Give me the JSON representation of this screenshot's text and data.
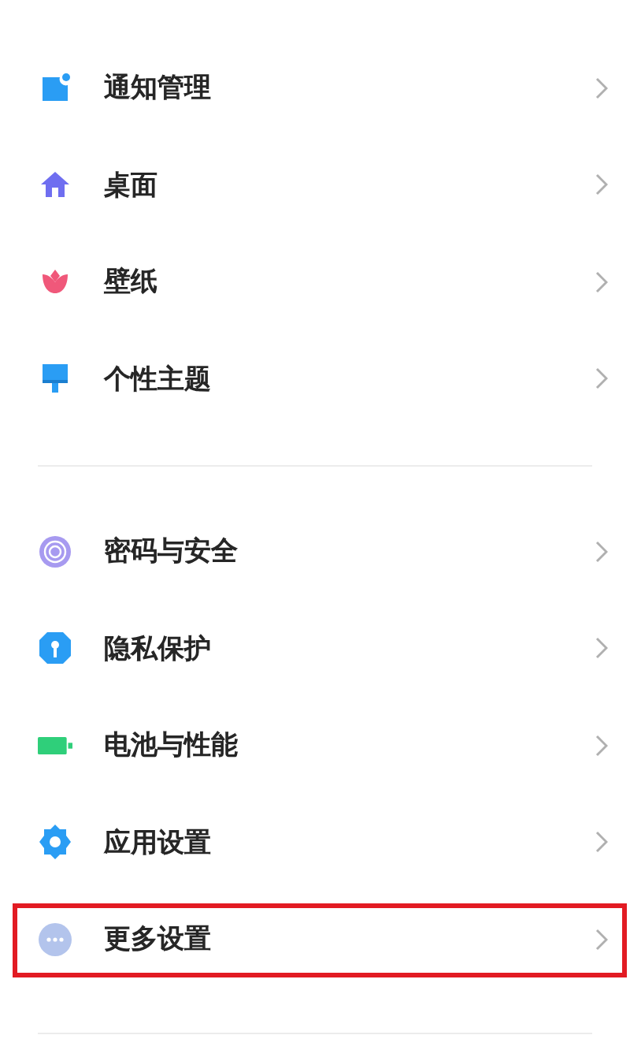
{
  "sections": [
    {
      "items": [
        {
          "label": "通知管理",
          "highlighted": false
        },
        {
          "label": "桌面",
          "highlighted": false
        },
        {
          "label": "壁纸",
          "highlighted": false
        },
        {
          "label": "个性主题",
          "highlighted": false
        }
      ]
    },
    {
      "items": [
        {
          "label": "密码与安全",
          "highlighted": false
        },
        {
          "label": "隐私保护",
          "highlighted": false
        },
        {
          "label": "电池与性能",
          "highlighted": false
        },
        {
          "label": "应用设置",
          "highlighted": false
        },
        {
          "label": "更多设置",
          "highlighted": true
        }
      ]
    }
  ]
}
